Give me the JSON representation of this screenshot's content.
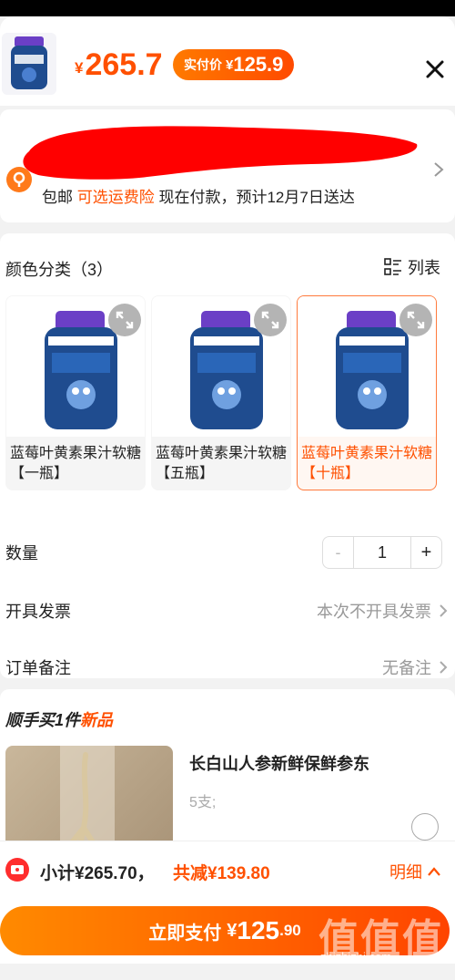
{
  "header": {
    "currency": "¥",
    "original_price": "265.7",
    "pay_label": "实付价",
    "pay_currency": "¥",
    "pay_price": "125.9",
    "close_icon": "close-icon"
  },
  "address": {
    "shipping_free": "包邮",
    "insurance": "可选运费险",
    "delivery": "现在付款，预计12月7日送达"
  },
  "sku": {
    "title": "颜色分类（3）",
    "list_view_label": "列表",
    "options": [
      {
        "name": "蓝莓叶黄素果汁软糖【一瓶】",
        "selected": false
      },
      {
        "name": "蓝莓叶黄素果汁软糖【五瓶】",
        "selected": false
      },
      {
        "name": "蓝莓叶黄素果汁软糖【十瓶】",
        "selected": true
      }
    ],
    "quantity_label": "数量",
    "quantity_value": "1",
    "minus": "-",
    "plus": "+",
    "invoice_label": "开具发票",
    "invoice_value": "本次不开具发票",
    "note_label": "订单备注",
    "note_value": "无备注"
  },
  "addon": {
    "title_prefix": "顺手买1件",
    "title_new": "新品",
    "product_name": "长白山人参新鲜保鲜参东",
    "product_spec": "5支;"
  },
  "footer": {
    "subtotal": "小计¥265.70，",
    "saved": "共减¥139.80",
    "detail": "明细",
    "pay_label": "立即支付",
    "pay_currency": "¥",
    "pay_int": "125",
    "pay_dec": ".90"
  },
  "watermark": {
    "text": "值值值",
    "url": "zhizhizhi.com"
  },
  "colors": {
    "accent": "#ff5000",
    "brand_gradient_start": "#ff8a00",
    "brand_gradient_end": "#ff4400"
  }
}
